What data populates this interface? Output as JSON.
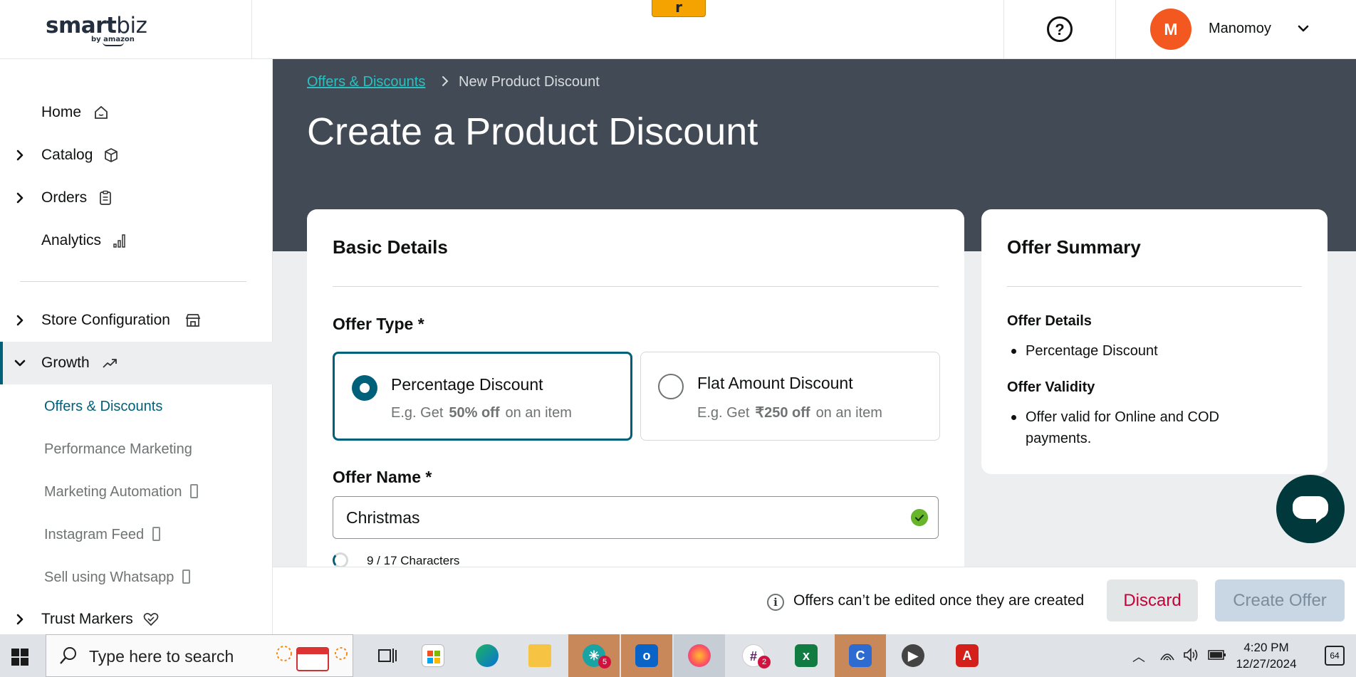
{
  "header": {
    "logo_main": "smart",
    "logo_biz": "biz",
    "logo_sub": "by amazon",
    "orange_tab_label": "r",
    "help_glyph": "?",
    "avatar_initial": "M",
    "user_name": "Manomoy"
  },
  "sidebar": {
    "items": [
      {
        "label": "Home",
        "icon": "home-icon"
      },
      {
        "label": "Catalog",
        "icon": "cube-icon"
      },
      {
        "label": "Orders",
        "icon": "clipboard-icon"
      },
      {
        "label": "Analytics",
        "icon": "bar-chart-icon"
      },
      {
        "label": "Store Configuration",
        "icon": "store-icon"
      },
      {
        "label": "Growth",
        "icon": "trend-up-icon"
      },
      {
        "label": "Trust Markers",
        "icon": "heart-shield-icon"
      }
    ],
    "growth_subitems": [
      {
        "label": "Offers & Discounts",
        "selected": true
      },
      {
        "label": "Performance Marketing",
        "selected": false
      },
      {
        "label": "Marketing Automation",
        "selected": false
      },
      {
        "label": "Instagram Feed",
        "selected": false
      },
      {
        "label": "Sell using Whatsapp",
        "selected": false
      }
    ]
  },
  "breadcrumb": {
    "link": "Offers & Discounts",
    "current": "New Product Discount"
  },
  "page": {
    "title": "Create a Product Discount"
  },
  "basic_details": {
    "heading": "Basic Details",
    "offer_type_label": "Offer Type *",
    "options": [
      {
        "title": "Percentage Discount",
        "desc_prefix": "E.g. Get",
        "desc_bold": "50% off",
        "desc_suffix": "on an item",
        "selected": true
      },
      {
        "title": "Flat Amount Discount",
        "desc_prefix": "E.g. Get",
        "desc_bold": "₹250 off",
        "desc_suffix": "on an item",
        "selected": false
      }
    ],
    "offer_name_label": "Offer Name *",
    "offer_name_value": "Christmas",
    "char_count": "9 / 17 Characters"
  },
  "summary": {
    "heading": "Offer Summary",
    "details_heading": "Offer Details",
    "details_item": "Percentage Discount",
    "validity_heading": "Offer Validity",
    "validity_item": "Offer valid for Online and COD payments."
  },
  "footer": {
    "info_text": "Offers can’t be edited once they are created",
    "discard_label": "Discard",
    "create_label": "Create Offer"
  },
  "taskbar": {
    "search_placeholder": "Type here to search",
    "time": "4:20 PM",
    "date": "12/27/2024",
    "notification_count": "64",
    "badges": {
      "app5": "5",
      "slack": "2"
    }
  },
  "colors": {
    "accent": "#00607a",
    "hero_bg": "#424b55",
    "discard_text": "#c7003a",
    "avatar": "#f2581f"
  }
}
